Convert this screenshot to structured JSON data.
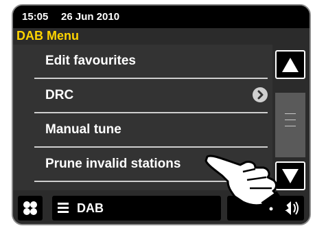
{
  "status": {
    "time": "15:05",
    "date": "26 Jun 2010"
  },
  "menu": {
    "title": "DAB Menu",
    "items": [
      {
        "label": "Edit favourites",
        "has_arrow": false
      },
      {
        "label": "DRC",
        "has_arrow": true
      },
      {
        "label": "Manual tune",
        "has_arrow": false
      },
      {
        "label": "Prune invalid stations",
        "has_arrow": false
      }
    ]
  },
  "bottom": {
    "mode_label": "DAB"
  },
  "icons": {
    "up": "up-arrow-icon",
    "down": "down-arrow-icon",
    "home": "home-grid-icon",
    "menu": "menu-lines-icon",
    "submenu": "chevron-right-icon",
    "volume": "speaker-icon",
    "pointer": "pointing-hand-icon"
  },
  "colors": {
    "accent_title": "#ffd400",
    "background": "#333333",
    "statusbar": "#000000"
  }
}
